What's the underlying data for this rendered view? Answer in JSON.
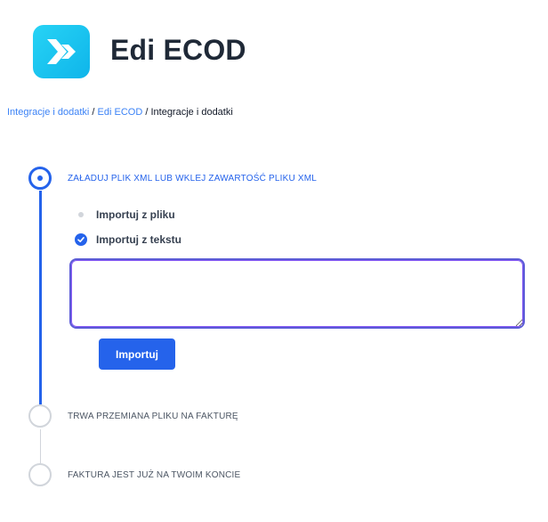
{
  "app": {
    "title": "Edi ECOD"
  },
  "breadcrumb": {
    "items": [
      "Integracje i dodatki",
      "Edi ECOD",
      "Integracje i dodatki"
    ],
    "separator": "/"
  },
  "steps": [
    {
      "label": "ZAŁADUJ PLIK XML LUB WKLEJ ZAWARTOŚĆ PLIKU XML",
      "state": "active"
    },
    {
      "label": "TRWA PRZEMIANA PLIKU NA FAKTURĘ",
      "state": "pending"
    },
    {
      "label": "FAKTURA JEST JUŻ NA TWOIM KONCIE",
      "state": "pending"
    }
  ],
  "import_options": [
    {
      "label": "Importuj z pliku",
      "selected": false
    },
    {
      "label": "Importuj z tekstu",
      "selected": true
    }
  ],
  "textarea": {
    "value": "",
    "placeholder": ""
  },
  "import_button": {
    "label": "Importuj"
  },
  "colors": {
    "accent": "#2563eb",
    "logo": "#1ec8f0",
    "link": "#3b82f6",
    "focus_border": "#5b5bd6"
  },
  "icons": {
    "logo": "ecod-logo-icon",
    "checked": "check-icon"
  }
}
